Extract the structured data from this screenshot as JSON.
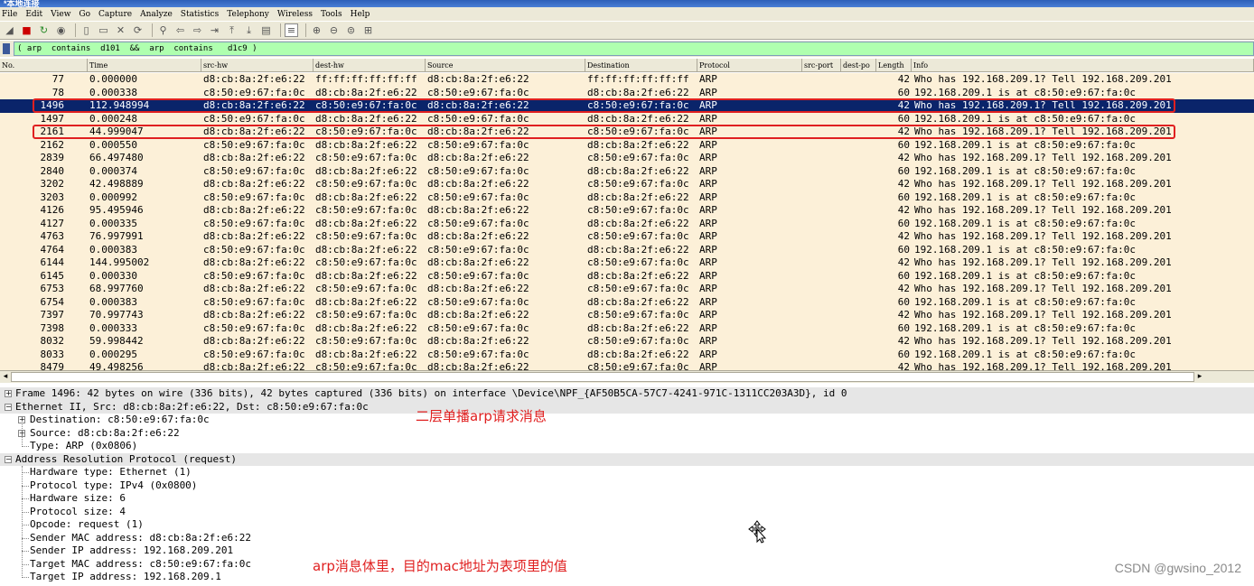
{
  "window": {
    "title": "*本地连接"
  },
  "menu": [
    "File",
    "Edit",
    "View",
    "Go",
    "Capture",
    "Analyze",
    "Statistics",
    "Telephony",
    "Wireless",
    "Tools",
    "Help"
  ],
  "filter": {
    "value": "( arp  contains  d101  &&  arp  contains   d1c9 )"
  },
  "columns": [
    "No.",
    "Time",
    "src-hw",
    "dest-hw",
    "Source",
    "Destination",
    "Protocol",
    "src-port",
    "dest-po",
    "Length",
    "Info"
  ],
  "packets": [
    {
      "no": "77",
      "time": "0.000000",
      "src_hw": "d8:cb:8a:2f:e6:22",
      "dest_hw": "ff:ff:ff:ff:ff:ff",
      "source": "d8:cb:8a:2f:e6:22",
      "destination": "ff:ff:ff:ff:ff:ff",
      "protocol": "ARP",
      "length": "42",
      "info": "Who has 192.168.209.1? Tell 192.168.209.201"
    },
    {
      "no": "78",
      "time": "0.000338",
      "src_hw": "c8:50:e9:67:fa:0c",
      "dest_hw": "d8:cb:8a:2f:e6:22",
      "source": "c8:50:e9:67:fa:0c",
      "destination": "d8:cb:8a:2f:e6:22",
      "protocol": "ARP",
      "length": "60",
      "info": "192.168.209.1 is at c8:50:e9:67:fa:0c"
    },
    {
      "no": "1496",
      "time": "112.948994",
      "src_hw": "d8:cb:8a:2f:e6:22",
      "dest_hw": "c8:50:e9:67:fa:0c",
      "source": "d8:cb:8a:2f:e6:22",
      "destination": "c8:50:e9:67:fa:0c",
      "protocol": "ARP",
      "length": "42",
      "info": "Who has 192.168.209.1? Tell 192.168.209.201",
      "selected": true
    },
    {
      "no": "1497",
      "time": "0.000248",
      "src_hw": "c8:50:e9:67:fa:0c",
      "dest_hw": "d8:cb:8a:2f:e6:22",
      "source": "c8:50:e9:67:fa:0c",
      "destination": "d8:cb:8a:2f:e6:22",
      "protocol": "ARP",
      "length": "60",
      "info": "192.168.209.1 is at c8:50:e9:67:fa:0c"
    },
    {
      "no": "2161",
      "time": "44.999047",
      "src_hw": "d8:cb:8a:2f:e6:22",
      "dest_hw": "c8:50:e9:67:fa:0c",
      "source": "d8:cb:8a:2f:e6:22",
      "destination": "c8:50:e9:67:fa:0c",
      "protocol": "ARP",
      "length": "42",
      "info": "Who has 192.168.209.1? Tell 192.168.209.201"
    },
    {
      "no": "2162",
      "time": "0.000550",
      "src_hw": "c8:50:e9:67:fa:0c",
      "dest_hw": "d8:cb:8a:2f:e6:22",
      "source": "c8:50:e9:67:fa:0c",
      "destination": "d8:cb:8a:2f:e6:22",
      "protocol": "ARP",
      "length": "60",
      "info": "192.168.209.1 is at c8:50:e9:67:fa:0c"
    },
    {
      "no": "2839",
      "time": "66.497480",
      "src_hw": "d8:cb:8a:2f:e6:22",
      "dest_hw": "c8:50:e9:67:fa:0c",
      "source": "d8:cb:8a:2f:e6:22",
      "destination": "c8:50:e9:67:fa:0c",
      "protocol": "ARP",
      "length": "42",
      "info": "Who has 192.168.209.1? Tell 192.168.209.201"
    },
    {
      "no": "2840",
      "time": "0.000374",
      "src_hw": "c8:50:e9:67:fa:0c",
      "dest_hw": "d8:cb:8a:2f:e6:22",
      "source": "c8:50:e9:67:fa:0c",
      "destination": "d8:cb:8a:2f:e6:22",
      "protocol": "ARP",
      "length": "60",
      "info": "192.168.209.1 is at c8:50:e9:67:fa:0c"
    },
    {
      "no": "3202",
      "time": "42.498889",
      "src_hw": "d8:cb:8a:2f:e6:22",
      "dest_hw": "c8:50:e9:67:fa:0c",
      "source": "d8:cb:8a:2f:e6:22",
      "destination": "c8:50:e9:67:fa:0c",
      "protocol": "ARP",
      "length": "42",
      "info": "Who has 192.168.209.1? Tell 192.168.209.201"
    },
    {
      "no": "3203",
      "time": "0.000992",
      "src_hw": "c8:50:e9:67:fa:0c",
      "dest_hw": "d8:cb:8a:2f:e6:22",
      "source": "c8:50:e9:67:fa:0c",
      "destination": "d8:cb:8a:2f:e6:22",
      "protocol": "ARP",
      "length": "60",
      "info": "192.168.209.1 is at c8:50:e9:67:fa:0c"
    },
    {
      "no": "4126",
      "time": "95.495946",
      "src_hw": "d8:cb:8a:2f:e6:22",
      "dest_hw": "c8:50:e9:67:fa:0c",
      "source": "d8:cb:8a:2f:e6:22",
      "destination": "c8:50:e9:67:fa:0c",
      "protocol": "ARP",
      "length": "42",
      "info": "Who has 192.168.209.1? Tell 192.168.209.201"
    },
    {
      "no": "4127",
      "time": "0.000335",
      "src_hw": "c8:50:e9:67:fa:0c",
      "dest_hw": "d8:cb:8a:2f:e6:22",
      "source": "c8:50:e9:67:fa:0c",
      "destination": "d8:cb:8a:2f:e6:22",
      "protocol": "ARP",
      "length": "60",
      "info": "192.168.209.1 is at c8:50:e9:67:fa:0c"
    },
    {
      "no": "4763",
      "time": "76.997991",
      "src_hw": "d8:cb:8a:2f:e6:22",
      "dest_hw": "c8:50:e9:67:fa:0c",
      "source": "d8:cb:8a:2f:e6:22",
      "destination": "c8:50:e9:67:fa:0c",
      "protocol": "ARP",
      "length": "42",
      "info": "Who has 192.168.209.1? Tell 192.168.209.201"
    },
    {
      "no": "4764",
      "time": "0.000383",
      "src_hw": "c8:50:e9:67:fa:0c",
      "dest_hw": "d8:cb:8a:2f:e6:22",
      "source": "c8:50:e9:67:fa:0c",
      "destination": "d8:cb:8a:2f:e6:22",
      "protocol": "ARP",
      "length": "60",
      "info": "192.168.209.1 is at c8:50:e9:67:fa:0c"
    },
    {
      "no": "6144",
      "time": "144.995002",
      "src_hw": "d8:cb:8a:2f:e6:22",
      "dest_hw": "c8:50:e9:67:fa:0c",
      "source": "d8:cb:8a:2f:e6:22",
      "destination": "c8:50:e9:67:fa:0c",
      "protocol": "ARP",
      "length": "42",
      "info": "Who has 192.168.209.1? Tell 192.168.209.201"
    },
    {
      "no": "6145",
      "time": "0.000330",
      "src_hw": "c8:50:e9:67:fa:0c",
      "dest_hw": "d8:cb:8a:2f:e6:22",
      "source": "c8:50:e9:67:fa:0c",
      "destination": "d8:cb:8a:2f:e6:22",
      "protocol": "ARP",
      "length": "60",
      "info": "192.168.209.1 is at c8:50:e9:67:fa:0c"
    },
    {
      "no": "6753",
      "time": "68.997760",
      "src_hw": "d8:cb:8a:2f:e6:22",
      "dest_hw": "c8:50:e9:67:fa:0c",
      "source": "d8:cb:8a:2f:e6:22",
      "destination": "c8:50:e9:67:fa:0c",
      "protocol": "ARP",
      "length": "42",
      "info": "Who has 192.168.209.1? Tell 192.168.209.201"
    },
    {
      "no": "6754",
      "time": "0.000383",
      "src_hw": "c8:50:e9:67:fa:0c",
      "dest_hw": "d8:cb:8a:2f:e6:22",
      "source": "c8:50:e9:67:fa:0c",
      "destination": "d8:cb:8a:2f:e6:22",
      "protocol": "ARP",
      "length": "60",
      "info": "192.168.209.1 is at c8:50:e9:67:fa:0c"
    },
    {
      "no": "7397",
      "time": "70.997743",
      "src_hw": "d8:cb:8a:2f:e6:22",
      "dest_hw": "c8:50:e9:67:fa:0c",
      "source": "d8:cb:8a:2f:e6:22",
      "destination": "c8:50:e9:67:fa:0c",
      "protocol": "ARP",
      "length": "42",
      "info": "Who has 192.168.209.1? Tell 192.168.209.201"
    },
    {
      "no": "7398",
      "time": "0.000333",
      "src_hw": "c8:50:e9:67:fa:0c",
      "dest_hw": "d8:cb:8a:2f:e6:22",
      "source": "c8:50:e9:67:fa:0c",
      "destination": "d8:cb:8a:2f:e6:22",
      "protocol": "ARP",
      "length": "60",
      "info": "192.168.209.1 is at c8:50:e9:67:fa:0c"
    },
    {
      "no": "8032",
      "time": "59.998442",
      "src_hw": "d8:cb:8a:2f:e6:22",
      "dest_hw": "c8:50:e9:67:fa:0c",
      "source": "d8:cb:8a:2f:e6:22",
      "destination": "c8:50:e9:67:fa:0c",
      "protocol": "ARP",
      "length": "42",
      "info": "Who has 192.168.209.1? Tell 192.168.209.201"
    },
    {
      "no": "8033",
      "time": "0.000295",
      "src_hw": "c8:50:e9:67:fa:0c",
      "dest_hw": "d8:cb:8a:2f:e6:22",
      "source": "c8:50:e9:67:fa:0c",
      "destination": "d8:cb:8a:2f:e6:22",
      "protocol": "ARP",
      "length": "60",
      "info": "192.168.209.1 is at c8:50:e9:67:fa:0c"
    },
    {
      "no": "8479",
      "time": "49.498256",
      "src_hw": "d8:cb:8a:2f:e6:22",
      "dest_hw": "c8:50:e9:67:fa:0c",
      "source": "d8:cb:8a:2f:e6:22",
      "destination": "c8:50:e9:67:fa:0c",
      "protocol": "ARP",
      "length": "42",
      "info": "Who has 192.168.209.1? Tell 192.168.209.201"
    }
  ],
  "highlighted_packets": [
    "1496",
    "2161"
  ],
  "details": {
    "frame": "Frame 1496: 42 bytes on wire (336 bits), 42 bytes captured (336 bits) on interface \\Device\\NPF_{AF50B5CA-57C7-4241-971C-1311CC203A3D}, id 0",
    "ethernet": "Ethernet II, Src: d8:cb:8a:2f:e6:22, Dst: c8:50:e9:67:fa:0c",
    "eth_dst": "Destination: c8:50:e9:67:fa:0c",
    "eth_src": "Source: d8:cb:8a:2f:e6:22",
    "eth_type": "Type: ARP (0x0806)",
    "arp": "Address Resolution Protocol (request)",
    "arp_fields": [
      "Hardware type: Ethernet (1)",
      "Protocol type: IPv4 (0x0800)",
      "Hardware size: 6",
      "Protocol size: 4",
      "Opcode: request (1)",
      "Sender MAC address: d8:cb:8a:2f:e6:22",
      "Sender IP address: 192.168.209.201",
      "Target MAC address: c8:50:e9:67:fa:0c",
      "Target IP address: 192.168.209.1"
    ]
  },
  "annotations": {
    "ethernet_note": "二层单播arp请求消息",
    "arp_note": "arp消息体里，目的mac地址为表项里的值"
  },
  "watermark": "CSDN @gwsino_2012",
  "colors": {
    "selected_row": "#0a246a",
    "list_bg": "#fcf0d8",
    "filter_bg": "#afffaf",
    "annotation": "#e02020"
  }
}
